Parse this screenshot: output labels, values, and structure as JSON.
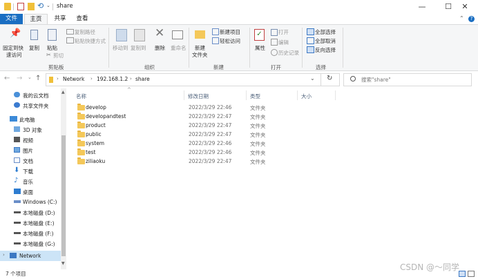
{
  "window": {
    "title": "share",
    "controls": {
      "minimize": "—",
      "maximize": "☐",
      "close": "✕"
    }
  },
  "ribbon_tabs": [
    "文件",
    "主页",
    "共享",
    "查看"
  ],
  "ribbon": {
    "clipboard": {
      "pin": "固定到快",
      "pin2": "速访问",
      "copy": "复制",
      "paste": "粘贴",
      "copy_path": "复制路径",
      "paste_shortcut": "粘贴快捷方式",
      "cut": "剪切",
      "label": "剪贴板"
    },
    "organize": {
      "move_to": "移动到",
      "copy_to": "复制到",
      "delete": "删除",
      "rename": "重命名",
      "label": "组织"
    },
    "new": {
      "new_folder": "新建",
      "new_folder2": "文件夹",
      "new_item": "新建项目",
      "easy_access": "轻松访问",
      "label": "新建"
    },
    "open": {
      "properties": "属性",
      "open": "打开",
      "edit": "编辑",
      "history": "历史记录",
      "label": "打开"
    },
    "select": {
      "select_all": "全部选择",
      "select_none": "全部取消",
      "invert": "反向选择",
      "label": "选择"
    }
  },
  "address": {
    "breadcrumb": [
      "Network",
      "192.168.1.2",
      "share"
    ],
    "search_placeholder": "搜索\"share\""
  },
  "nav_pane": [
    {
      "label": "我的云文档",
      "icon": "cloud-icon"
    },
    {
      "label": "共享文件夹",
      "icon": "share-folder-icon"
    },
    {
      "label": "此电脑",
      "icon": "pc-icon"
    },
    {
      "label": "3D 对象",
      "icon": "3d-objects-icon"
    },
    {
      "label": "视频",
      "icon": "video-icon"
    },
    {
      "label": "图片",
      "icon": "pictures-icon"
    },
    {
      "label": "文档",
      "icon": "documents-icon"
    },
    {
      "label": "下载",
      "icon": "download-icon"
    },
    {
      "label": "音乐",
      "icon": "music-icon"
    },
    {
      "label": "桌面",
      "icon": "desktop-icon"
    },
    {
      "label": "Windows (C:)",
      "icon": "drive-icon"
    },
    {
      "label": "本地磁盘 (D:)",
      "icon": "drive-icon"
    },
    {
      "label": "本地磁盘 (E:)",
      "icon": "drive-icon"
    },
    {
      "label": "本地磁盘 (F:)",
      "icon": "drive-icon"
    },
    {
      "label": "本地磁盘 (G:)",
      "icon": "drive-icon"
    },
    {
      "label": "Network",
      "icon": "network-icon"
    }
  ],
  "columns": [
    "名称",
    "修改日期",
    "类型",
    "大小"
  ],
  "files": [
    {
      "name": "develop",
      "date": "2022/3/29 22:46",
      "type": "文件夹"
    },
    {
      "name": "developandtest",
      "date": "2022/3/29 22:47",
      "type": "文件夹"
    },
    {
      "name": "product",
      "date": "2022/3/29 22:47",
      "type": "文件夹"
    },
    {
      "name": "public",
      "date": "2022/3/29 22:47",
      "type": "文件夹"
    },
    {
      "name": "system",
      "date": "2022/3/29 22:46",
      "type": "文件夹"
    },
    {
      "name": "test",
      "date": "2022/3/29 22:46",
      "type": "文件夹"
    },
    {
      "name": "ziliaoku",
      "date": "2022/3/29 22:47",
      "type": "文件夹"
    }
  ],
  "status": "7 个项目",
  "watermark": "CSDN @～同学"
}
